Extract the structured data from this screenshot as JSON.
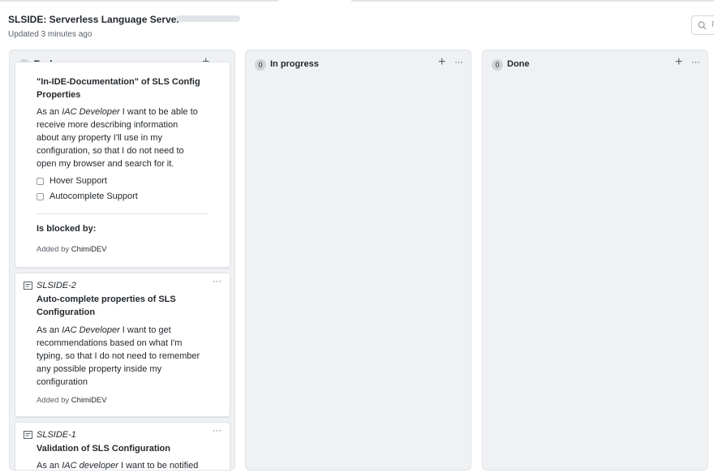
{
  "project": {
    "title": "SLSIDE: Serverless Language Server",
    "updated": "Updated 3 minutes ago"
  },
  "filter": {
    "placeholder": "F"
  },
  "columns": [
    {
      "name": "To do",
      "count": "3",
      "cards": [
        {
          "title_line1": "\"In-IDE-Documentation\" of SLS Config",
          "title_line2": "Properties",
          "body_prefix": "As an ",
          "body_role": "IAC Developer",
          "body_line1_rest": " I want to be able to",
          "body_lines": [
            "receive more describing information",
            "about any property I'll use in my",
            "configuration, so that I do not need to",
            "open my browser and search for it."
          ],
          "tasks": [
            "Hover Support",
            "Autocomplete Support"
          ],
          "blocked_label": "Is blocked by:",
          "added_prefix": "Added by ",
          "added_by": "ChimiDEV"
        },
        {
          "ref": "SLSIDE-2",
          "title_line1": "Auto-complete properties of SLS",
          "title_line2": "Configuration",
          "body_prefix": "As an ",
          "body_role": "IAC Developer",
          "body_line1_rest": " I want to get",
          "body_lines": [
            "recommendations based on what I'm",
            "typing, so that I do not need to remember",
            "any possible property inside my",
            "configuration"
          ],
          "added_prefix": "Added by ",
          "added_by": "ChimiDEV"
        },
        {
          "ref": "SLSIDE-1",
          "title_line1": "Validation of SLS Configuration",
          "body_prefix": "As an ",
          "body_role": "IAC developer",
          "body_line1_rest": " I want to be notified"
        }
      ]
    },
    {
      "name": "In progress",
      "count": "0"
    },
    {
      "name": "Done",
      "count": "0"
    }
  ],
  "icons": {
    "add": "+",
    "more": "···"
  }
}
